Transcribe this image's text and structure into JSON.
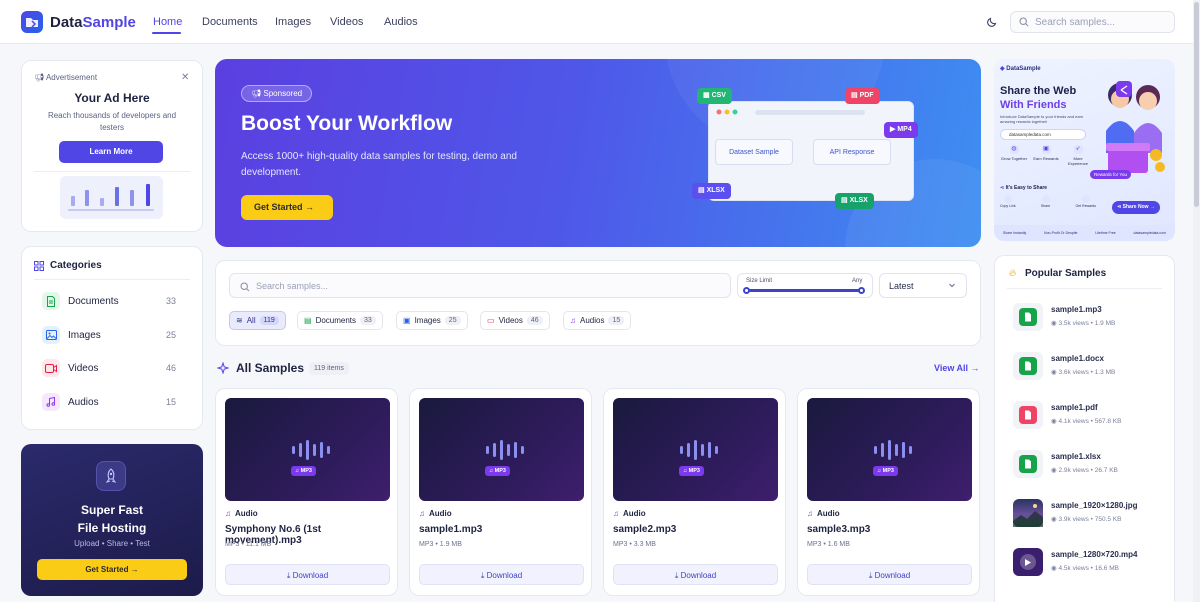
{
  "brand": {
    "part1": "Data",
    "part2": "Sample"
  },
  "nav": [
    "Home",
    "Documents",
    "Images",
    "Videos",
    "Audios"
  ],
  "search_placeholder": "Search samples...",
  "ad": {
    "label": "Advertisement",
    "title": "Your Ad Here",
    "subtitle": "Reach thousands of developers and testers",
    "button": "Learn More"
  },
  "categories": {
    "title": "Categories",
    "items": [
      {
        "label": "Documents",
        "count": "33"
      },
      {
        "label": "Images",
        "count": "25"
      },
      {
        "label": "Videos",
        "count": "46"
      },
      {
        "label": "Audios",
        "count": "15"
      }
    ]
  },
  "hosting": {
    "title1": "Super Fast",
    "title2": "File Hosting",
    "subtitle": "Upload • Share • Test",
    "button": "Get Started →"
  },
  "hero": {
    "badge": "Sponsored",
    "title": "Boost Your Workflow",
    "description": "Access 1000+ high-quality data samples for testing, demo and development.",
    "button": "Get Started",
    "mock_left": "Dataset Sample",
    "mock_right": "API Response",
    "tags": [
      "CSV",
      "PDF",
      "MP4",
      "XLSX",
      "XLSX"
    ]
  },
  "filters": {
    "search_placeholder": "Search samples...",
    "size_label": "Size Limit",
    "size_value": "Any",
    "sort": "Latest",
    "pills": [
      {
        "label": "All",
        "count": "119"
      },
      {
        "label": "Documents",
        "count": "33"
      },
      {
        "label": "Images",
        "count": "25"
      },
      {
        "label": "Videos",
        "count": "46"
      },
      {
        "label": "Audios",
        "count": "15"
      }
    ]
  },
  "section": {
    "title": "All Samples",
    "count": "119 items",
    "view_all": "View All →"
  },
  "samples": [
    {
      "badge": "MP3",
      "type": "Audio",
      "name": "Symphony No.6 (1st movement).mp3",
      "meta": "MP3 • 11.1 MB",
      "button": "Download"
    },
    {
      "badge": "MP3",
      "type": "Audio",
      "name": "sample1.mp3",
      "meta": "MP3 • 1.9 MB",
      "button": "Download"
    },
    {
      "badge": "MP3",
      "type": "Audio",
      "name": "sample2.mp3",
      "meta": "MP3 • 3.3 MB",
      "button": "Download"
    },
    {
      "badge": "MP3",
      "type": "Audio",
      "name": "sample3.mp3",
      "meta": "MP3 • 1.6 MB",
      "button": "Download"
    }
  ],
  "banner": {
    "brand": "DataSample",
    "title1": "Share the Web",
    "title2": "With Friends",
    "intro": "Introduce DataSample to your friends and earn amazing rewards together!",
    "link": "datasampledata.com",
    "features": [
      "Grow Together",
      "Earn Rewards",
      "More Experience"
    ],
    "easy": "It's Easy to Share",
    "steps": [
      "Copy Link",
      "Share",
      "Get Rewards"
    ],
    "share_button": "Share Now",
    "rewards": "Rewards for You",
    "footer": [
      "Share Instantly",
      "Non-Profit Or Despite",
      "Lifetime Free",
      "datasampledata.com"
    ]
  },
  "popular": {
    "title": "Popular Samples",
    "items": [
      {
        "name": "sample1.mp3",
        "views": "3.5k views",
        "size": "1.9 MB",
        "kind": "audio"
      },
      {
        "name": "sample1.docx",
        "views": "3.6k views",
        "size": "1.3 MB",
        "kind": "doc"
      },
      {
        "name": "sample1.pdf",
        "views": "4.1k views",
        "size": "567.8 KB",
        "kind": "pdf"
      },
      {
        "name": "sample1.xlsx",
        "views": "2.9k views",
        "size": "26.7 KB",
        "kind": "sheet"
      },
      {
        "name": "sample_1920×1280.jpg",
        "views": "3.9k views",
        "size": "750.5 KB",
        "kind": "image"
      },
      {
        "name": "sample_1280×720.mp4",
        "views": "4.5k views",
        "size": "16.6 MB",
        "kind": "video"
      }
    ]
  },
  "colors": {
    "accent": "#4f46e5",
    "cta": "#facc15",
    "hero_from": "#5b3fe0",
    "hero_to": "#3d8ef2"
  }
}
